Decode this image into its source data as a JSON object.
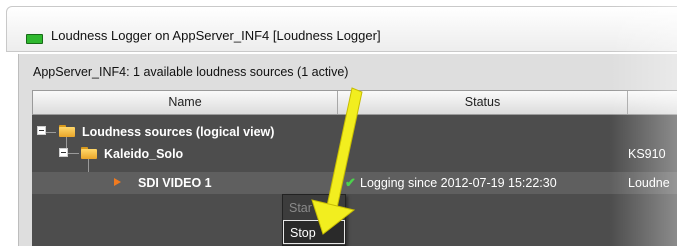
{
  "window": {
    "title": "Loudness Logger on AppServer_INF4 [Loudness Logger]"
  },
  "summary": "AppServer_INF4: 1 available loudness sources (1 active)",
  "columns": [
    {
      "label": "Name"
    },
    {
      "label": "Status"
    },
    {
      "label": ""
    }
  ],
  "tree": {
    "root": {
      "label": "Loudness sources (logical view)"
    },
    "group": {
      "label": "Kaleido_Solo",
      "trailing": "KS910"
    },
    "source": {
      "label": "SDI VIDEO 1",
      "status": "Logging since 2012-07-19 15:22:30",
      "trailing": "Loudne"
    }
  },
  "context_menu": {
    "items": [
      {
        "label": "Start",
        "state": "disabled",
        "visible_text": "Star"
      },
      {
        "label": "Stop",
        "state": "highlighted"
      }
    ]
  },
  "colors": {
    "callout_arrow": "#f2ee1f",
    "status_ok": "#4cd24c",
    "title_icon": "#2fb82f"
  },
  "icons": {
    "title": "monitor-icon",
    "folder": "folder-icon",
    "source": "audio-source-icon",
    "check": "checkmark-icon",
    "callout": "callout-arrow"
  }
}
